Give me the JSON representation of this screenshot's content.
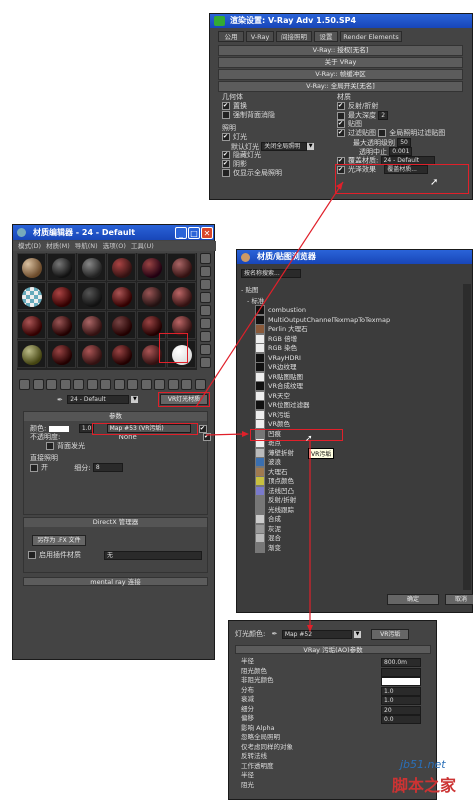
{
  "render": {
    "title": "渲染设置: V-Ray Adv 1.50.SP4",
    "tabs": [
      "公用",
      "V-Ray",
      "间接照明",
      "设置",
      "Render Elements"
    ],
    "rollouts": [
      "V-Ray:: 授权[无名]",
      "关于 VRay",
      "V-Ray:: 帧缓冲区",
      "V-Ray:: 全局开关[无名]"
    ],
    "geometry_header": "几何体",
    "geometry": [
      {
        "label": "置换",
        "on": true
      },
      {
        "label": "强制背面消隐",
        "on": false
      }
    ],
    "lighting_header": "照明",
    "light_on": "灯光",
    "default_lights_label": "默认灯光",
    "default_lights_value": "关闭全局照明",
    "lighting": [
      {
        "label": "隐藏灯光",
        "on": true
      },
      {
        "label": "阴影",
        "on": true
      },
      {
        "label": "仅显示全局照明",
        "on": false
      }
    ],
    "materials_header": "材质",
    "reflect_refract": "反射/折射",
    "max_depth": "最大深度",
    "max_depth_value": "2",
    "maps": "贴图",
    "filter_maps": "过滤贴图",
    "filter_maps_gi": "全局照明过滤贴图",
    "max_transp_label": "最大透明级别",
    "max_transp_value": "50",
    "transp_cutoff_label": "透明中止",
    "transp_cutoff_value": "0.001",
    "override_mtl": "覆盖材质:",
    "override_mtl_value": "24 - Default",
    "glossy_effects": "光泽效果",
    "glossy_value": "覆盖材质..."
  },
  "mat_editor": {
    "title": "材质编辑器 - 24 - Default",
    "menu": [
      "模式(D)",
      "材质(M)",
      "导航(N)",
      "选项(O)",
      "工具(U)"
    ],
    "slot_name": "24 - Default",
    "material_type": "VR灯光材质",
    "params_header": "参数",
    "color_label": "颜色:",
    "color_multiplier": "1.0",
    "map_label": "Map #53 (VR污垢)",
    "opacity_label": "不透明度:",
    "opacity_value": "None",
    "emit_back": "背面发光",
    "direct_header": "直接照明",
    "direct_on": "开",
    "subdivs_label": "细分:",
    "subdivs_value": "8",
    "directx_header": "DirectX 管理器",
    "save_fx": "另存为 .FX 文件",
    "enable_plugin": "启用插件材质",
    "plugin_value": "无",
    "mentalray": "mental ray 连接"
  },
  "browser": {
    "title": "材质/贴图浏览器",
    "search_placeholder": "按名称搜索...",
    "section": "- 贴图",
    "subsection": "- 标准",
    "items": [
      {
        "label": "combustion",
        "color": "#111111"
      },
      {
        "label": "MultiOutputChannelTexmapToTexmap",
        "color": "#111111"
      },
      {
        "label": "Perlin 大理石",
        "color": "#8a5a3a"
      },
      {
        "label": "RGB 倍增",
        "color": "#eeeeee"
      },
      {
        "label": "RGB 染色",
        "color": "#eeeeee"
      },
      {
        "label": "VRayHDRI",
        "color": "#111111"
      },
      {
        "label": "VR边纹理",
        "color": "#111111"
      },
      {
        "label": "VR贴图贴图",
        "color": "#eeeeee"
      },
      {
        "label": "VR合成纹理",
        "color": "#111111"
      },
      {
        "label": "VR天空",
        "color": "#eeeeee"
      },
      {
        "label": "VR位图过滤器",
        "color": "#111111"
      },
      {
        "label": "VR污垢",
        "color": "#eeeeee"
      },
      {
        "label": "VR颜色",
        "color": "#eeeeee"
      },
      {
        "label": "凹痕",
        "color": "#777777"
      },
      {
        "label": "斑点",
        "color": "#eeeeee"
      },
      {
        "label": "薄壁折射",
        "color": "#bbbbbb"
      },
      {
        "label": "波浪",
        "color": "#3a6fb0"
      },
      {
        "label": "大理石",
        "color": "#a07a50"
      },
      {
        "label": "顶点颜色",
        "color": "#c8c040"
      },
      {
        "label": "法线凹凸",
        "color": "#7a7acc"
      },
      {
        "label": "反射/折射",
        "color": "#777777"
      },
      {
        "label": "光线跟踪",
        "color": "#777777"
      },
      {
        "label": "合成",
        "color": "#cccccc"
      },
      {
        "label": "灰泥",
        "color": "#999999"
      },
      {
        "label": "混合",
        "color": "#bbbbbb"
      },
      {
        "label": "渐变",
        "color": "#777777"
      }
    ],
    "tooltip": "VR污垢",
    "ok": "确定",
    "cancel": "取消"
  },
  "dirt": {
    "ao_label": "灯光颜色:",
    "map_name": "Map #52",
    "map_type": "VR污垢",
    "header": "VRay 污垢(AO)参数",
    "params": [
      {
        "label": "半径",
        "value": "800.0m"
      },
      {
        "label": "阻光颜色",
        "value": ""
      },
      {
        "label": "非阻光颜色",
        "value": ""
      },
      {
        "label": "分布",
        "value": "1.0"
      },
      {
        "label": "衰减",
        "value": "1.0"
      },
      {
        "label": "细分",
        "value": "20"
      },
      {
        "label": "偏移",
        "value": "0.0"
      },
      {
        "label": "影响 Alpha",
        "value": ""
      },
      {
        "label": "忽略全局照明",
        "value": ""
      },
      {
        "label": "仅考虑同样的对象",
        "value": ""
      },
      {
        "label": "反转法线",
        "value": ""
      },
      {
        "label": "工作透明度",
        "value": ""
      },
      {
        "label": "半径",
        "value": ""
      },
      {
        "label": "阻光",
        "value": ""
      }
    ]
  },
  "watermark": {
    "site": "jb51.net",
    "name": "脚本之家"
  }
}
